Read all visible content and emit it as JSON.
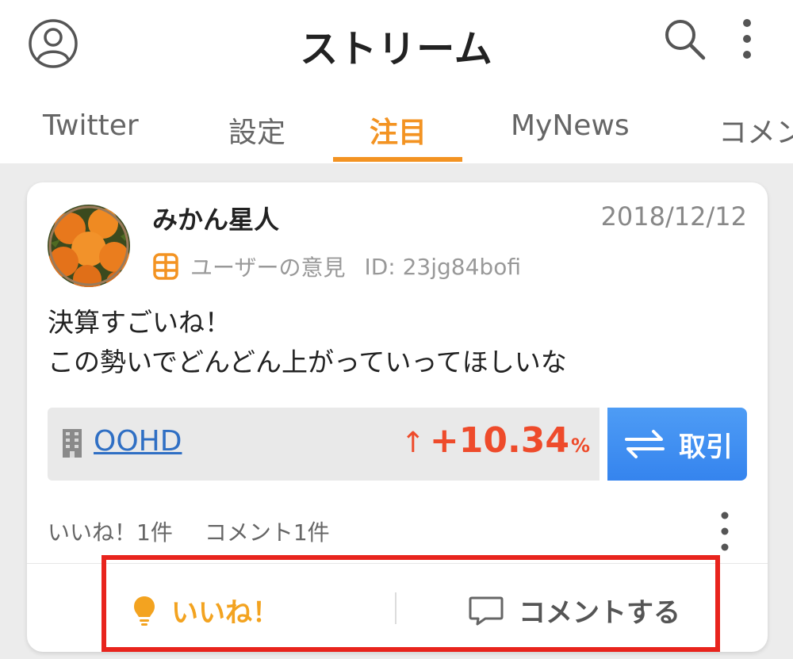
{
  "header": {
    "title": "ストリーム",
    "left_icon": "account-circle-icon",
    "right_icons": [
      "search-icon",
      "more-vertical-icon"
    ]
  },
  "tabs": [
    {
      "label": "Twitter",
      "active": false
    },
    {
      "label": "設定",
      "active": false
    },
    {
      "label": "注目",
      "active": true
    },
    {
      "label": "MyNews",
      "active": false
    },
    {
      "label": "コメン",
      "active": false
    }
  ],
  "post": {
    "user_name": "みかん星人",
    "date": "2018/12/12",
    "type_label": "ユーザーの意見",
    "user_id": "ID: 23jg84bofi",
    "body_lines": [
      "決算すごいね！",
      "この勢いでどんどん上がっていってほしいな"
    ],
    "stock": {
      "name": "OOHD",
      "arrow": "↑",
      "change": "+10.34",
      "unit": "%"
    },
    "trade_label": "取引",
    "stats": {
      "likes": "いいね！1件",
      "comments": "コメント1件"
    },
    "actions": {
      "like_label": "いいね！",
      "comment_label": "コメントする"
    }
  },
  "colors": {
    "accent_orange": "#f39322",
    "like_orange": "#f3a320",
    "stock_up_red": "#ee4b2b",
    "trade_blue": "#3584ee",
    "link_blue": "#2f6fc4",
    "highlight_red": "#e8241d"
  }
}
